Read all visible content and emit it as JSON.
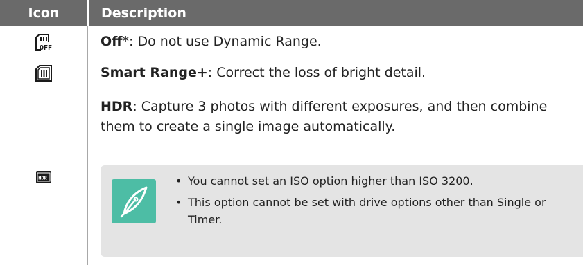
{
  "table": {
    "headers": {
      "icon": "Icon",
      "description": "Description"
    },
    "rows": [
      {
        "icon": "dr-off-icon",
        "term": "Off",
        "suffix": "*: Do not use Dynamic Range."
      },
      {
        "icon": "smart-range-plus-icon",
        "term": "Smart Range+",
        "suffix": ": Correct the loss of bright detail."
      },
      {
        "icon": "hdr-icon",
        "term": "HDR",
        "suffix": ": Capture 3 photos with different exposures, and then combine them to create a single image automatically."
      }
    ]
  },
  "note": {
    "icon": "pen-note-icon",
    "bullets": [
      "You cannot set an ISO option higher than ISO 3200.",
      "This option cannot be set with drive options other than Single or Timer."
    ]
  }
}
